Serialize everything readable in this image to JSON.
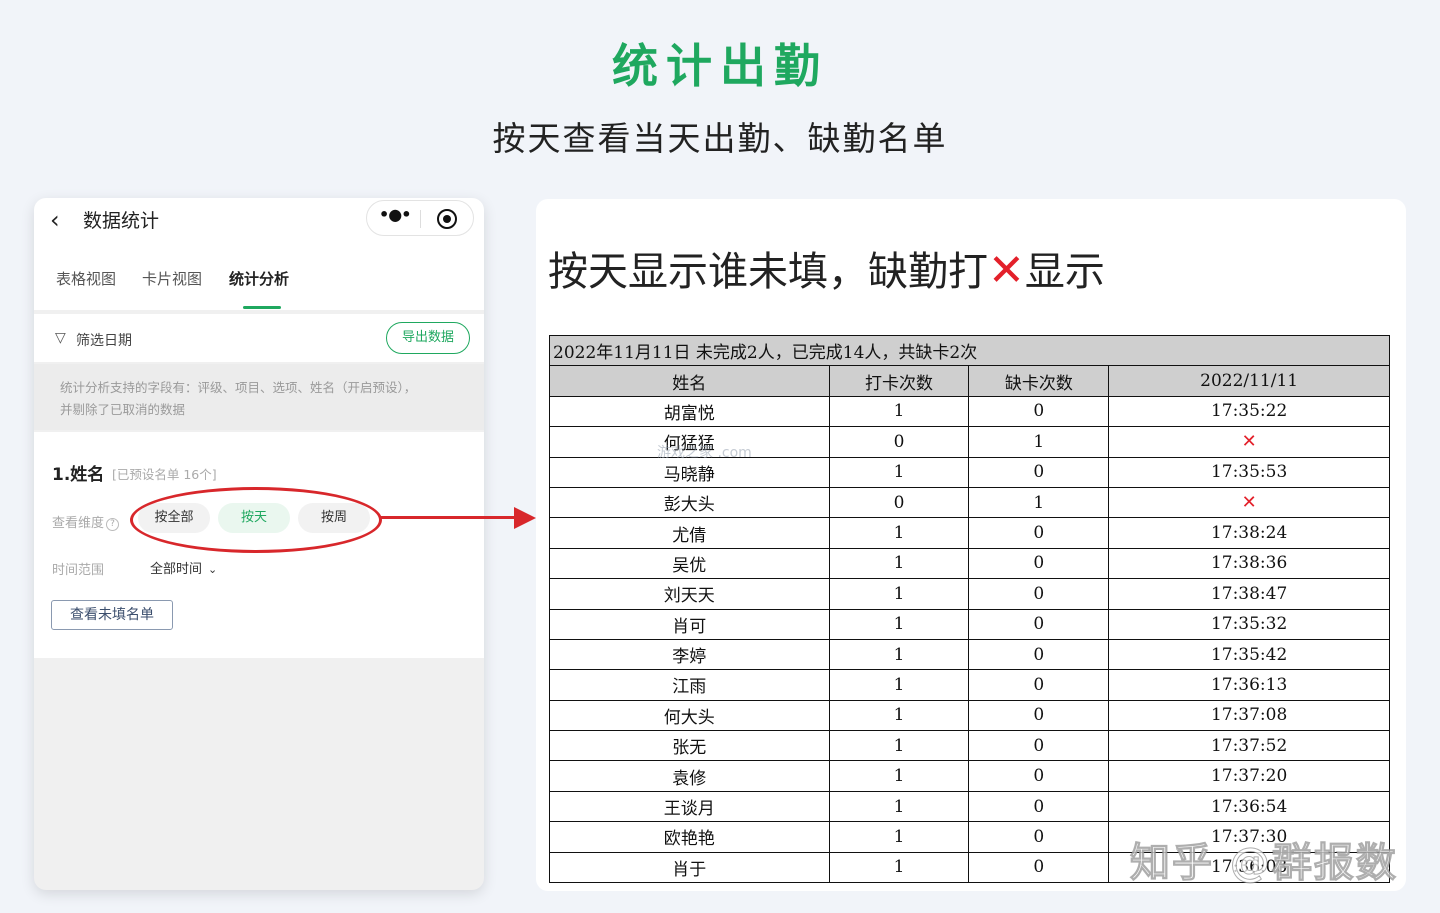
{
  "header": {
    "title": "统计出勤",
    "subtitle": "按天查看当天出勤、缺勤名单"
  },
  "phone": {
    "title": "数据统计",
    "icons": {
      "back": "chevron-left-icon",
      "more": "more-dots-icon",
      "close": "target-icon",
      "filter": "filter-icon",
      "help": "question-icon",
      "dropdown": "chevron-down-icon"
    },
    "tabs": [
      {
        "label": "表格视图"
      },
      {
        "label": "卡片视图"
      },
      {
        "label": "统计分析"
      }
    ],
    "filter_label": "筛选日期",
    "export_label": "导出数据",
    "hint_lines": [
      "统计分析支持的字段有：评级、项目、选项、姓名（开启预设），",
      "并剔除了已取消的数据"
    ],
    "section_title": "1.姓名",
    "section_sub": "[已预设名单 16个]",
    "dimension_label": "查看维度",
    "dimension_options": [
      "按全部",
      "按天",
      "按周"
    ],
    "selected_dimension": "按天",
    "range_label": "时间范围",
    "range_value": "全部时间",
    "view_unfilled_label": "查看未填名单"
  },
  "right": {
    "title_part1": "按天显示谁未填，缺勤打",
    "title_x": "✕",
    "title_part2": "显示",
    "accent_color": "#e3202a"
  },
  "table": {
    "summary": "2022年11月11日 未完成2人，已完成14人，共缺卡2次",
    "headers": [
      "姓名",
      "打卡次数",
      "缺卡次数",
      "2022/11/11"
    ],
    "rows": [
      [
        "胡富悦",
        "1",
        "0",
        "17:35:22"
      ],
      [
        "何猛猛",
        "0",
        "1",
        "✕"
      ],
      [
        "马晓静",
        "1",
        "0",
        "17:35:53"
      ],
      [
        "彭大头",
        "0",
        "1",
        "✕"
      ],
      [
        "尤倩",
        "1",
        "0",
        "17:38:24"
      ],
      [
        "吴优",
        "1",
        "0",
        "17:38:36"
      ],
      [
        "刘天天",
        "1",
        "0",
        "17:38:47"
      ],
      [
        "肖可",
        "1",
        "0",
        "17:35:32"
      ],
      [
        "李婷",
        "1",
        "0",
        "17:35:42"
      ],
      [
        "江雨",
        "1",
        "0",
        "17:36:13"
      ],
      [
        "何大头",
        "1",
        "0",
        "17:37:08"
      ],
      [
        "张无",
        "1",
        "0",
        "17:37:52"
      ],
      [
        "袁修",
        "1",
        "0",
        "17:37:20"
      ],
      [
        "王谈月",
        "1",
        "0",
        "17:36:54"
      ],
      [
        "欧艳艳",
        "1",
        "0",
        "17:37:30"
      ],
      [
        "肖于",
        "1",
        "0",
        "17:36:03"
      ]
    ]
  },
  "watermarks": {
    "site": "游戏之家 .com",
    "zhihu": "知乎 @群报数"
  },
  "colors": {
    "brand_green": "#1fa85f",
    "annotation_red": "#d8272b"
  }
}
